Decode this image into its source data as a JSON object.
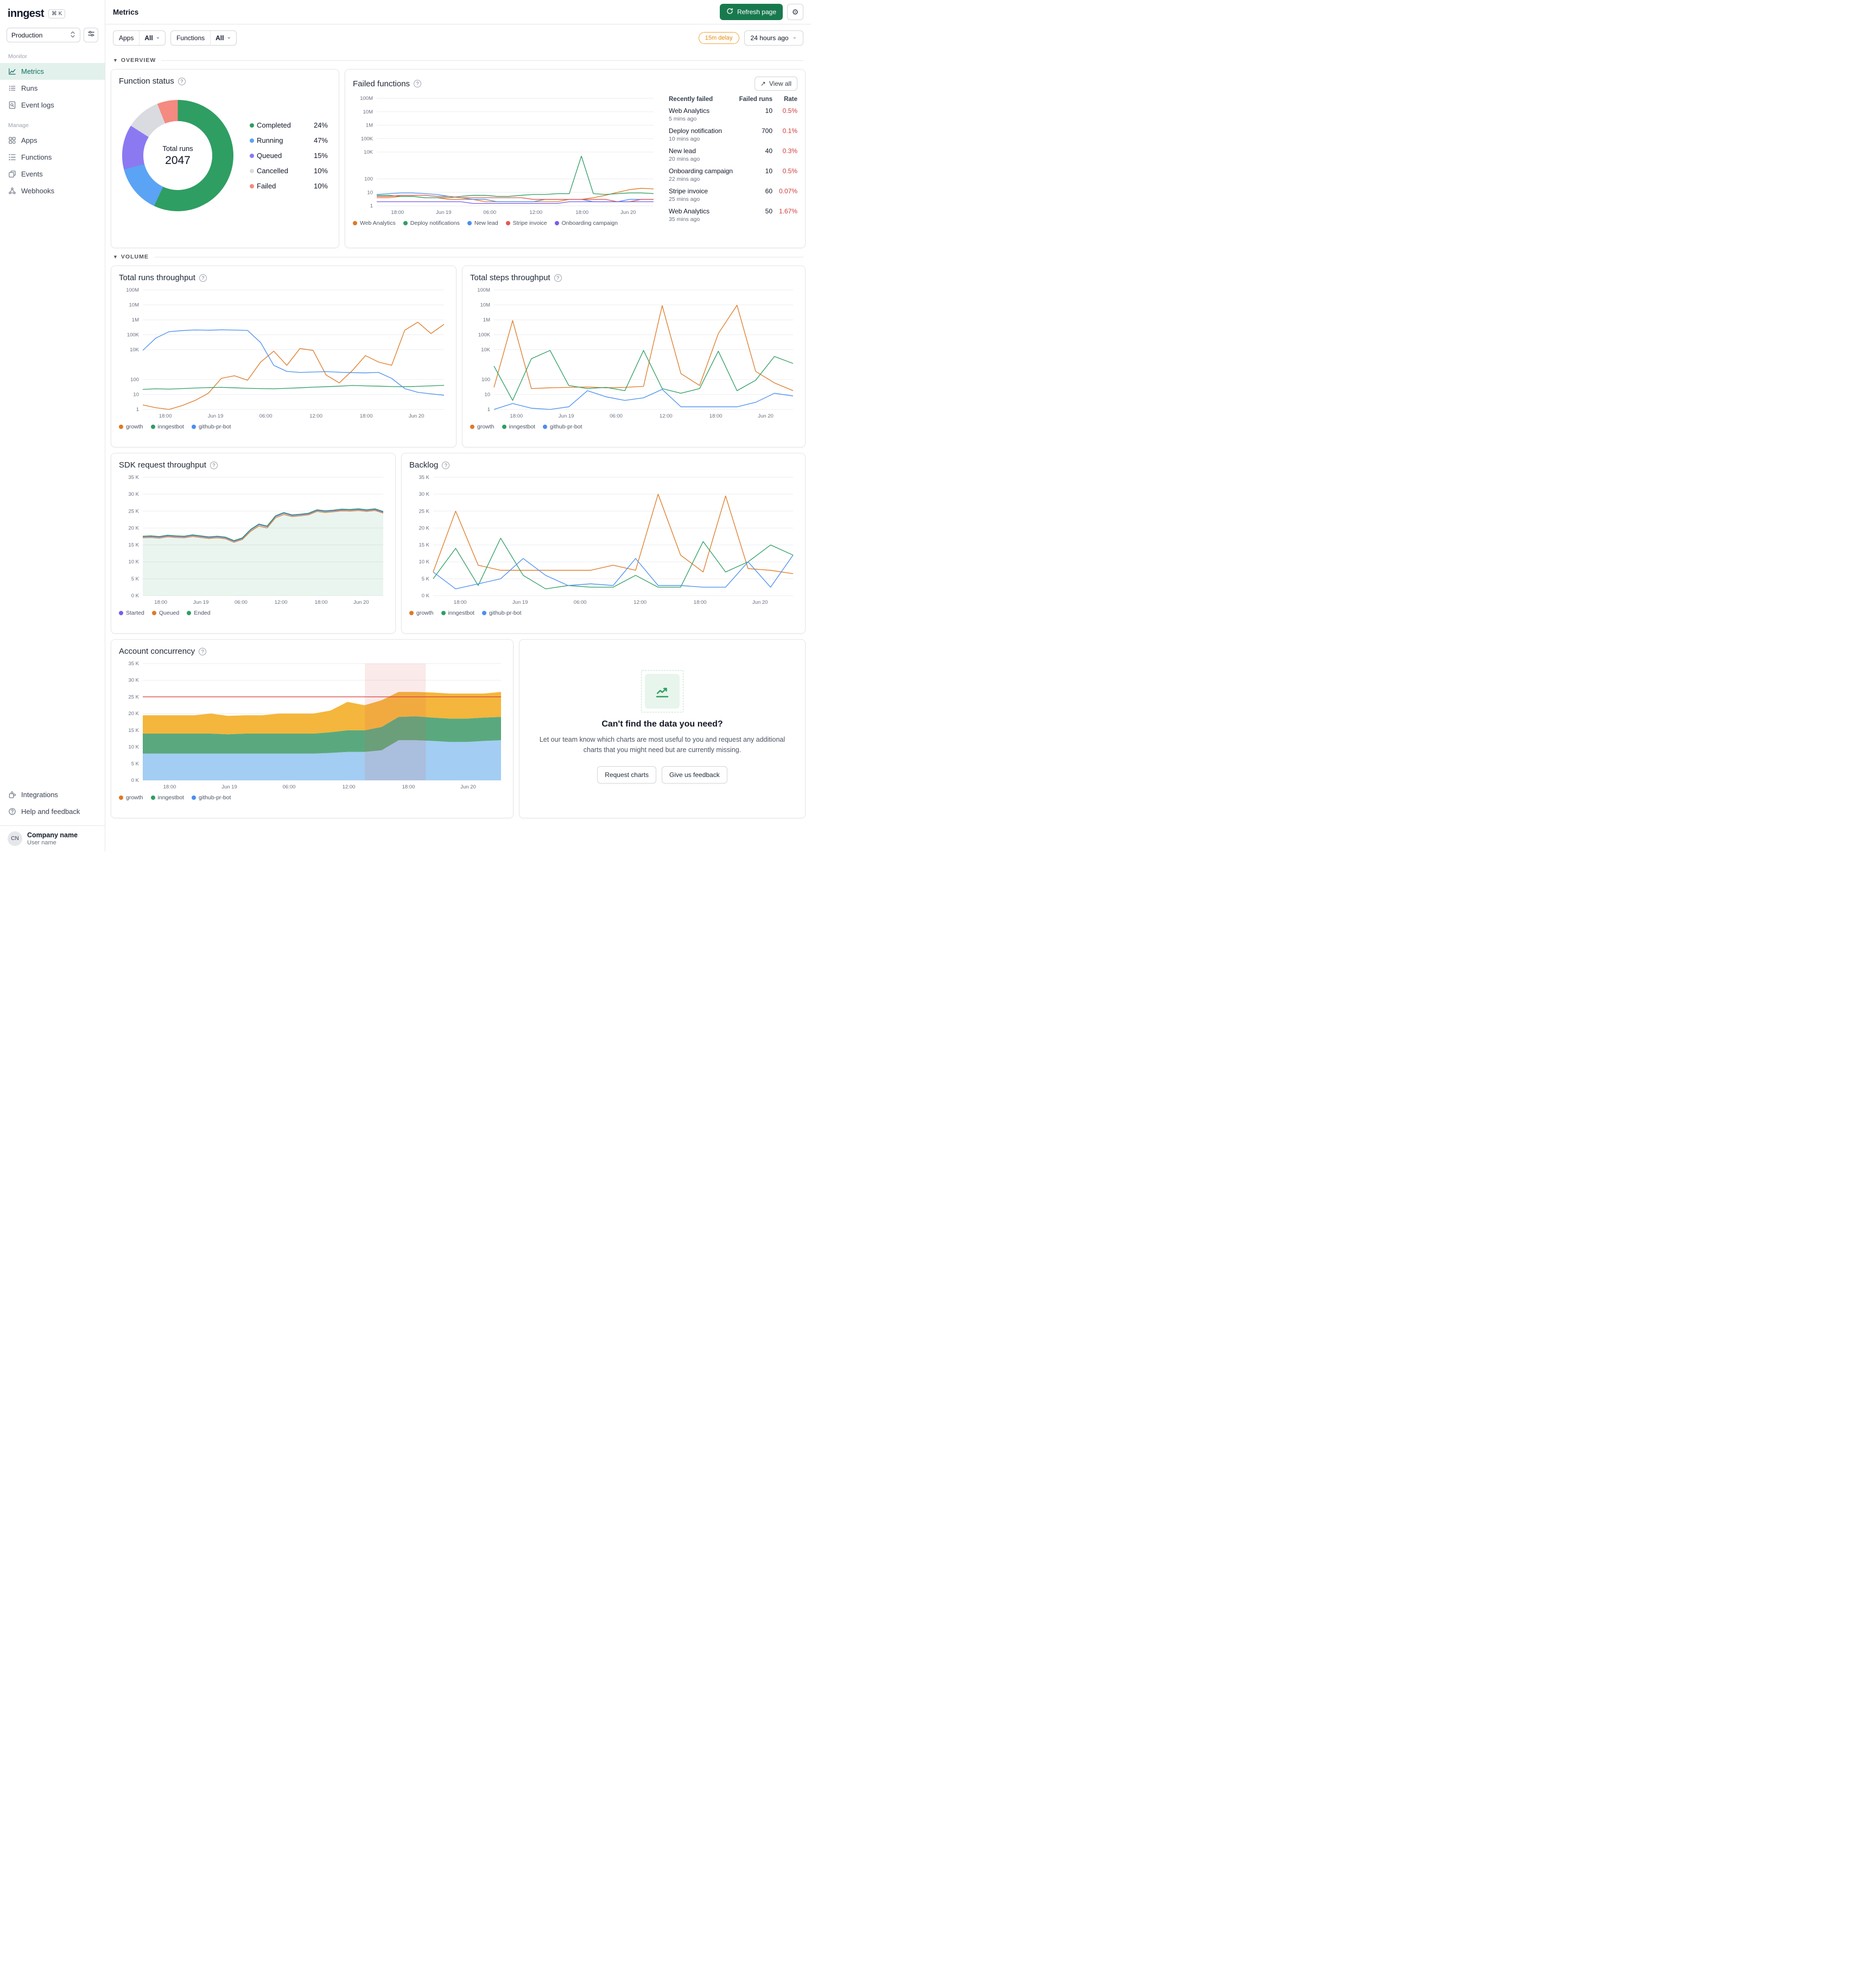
{
  "colors": {
    "accent_green": "#19794e",
    "badge_orange": "#e9890c",
    "error_red": "#d13d3d",
    "active_bg": "#e3f1ec",
    "active_text": "#12715f"
  },
  "sidebar": {
    "logo": "inngest",
    "kbd": "⌘ K",
    "env_selector": "Production",
    "sections": [
      {
        "label": "Monitor",
        "items": [
          {
            "label": "Metrics",
            "icon": "metrics",
            "active": true
          },
          {
            "label": "Runs",
            "icon": "runs"
          },
          {
            "label": "Event logs",
            "icon": "event-logs"
          }
        ]
      },
      {
        "label": "Manage",
        "items": [
          {
            "label": "Apps",
            "icon": "apps"
          },
          {
            "label": "Functions",
            "icon": "functions"
          },
          {
            "label": "Events",
            "icon": "events"
          },
          {
            "label": "Webhooks",
            "icon": "webhooks"
          }
        ]
      }
    ],
    "footer_items": [
      {
        "label": "Integrations",
        "icon": "integrations"
      },
      {
        "label": "Help and feedback",
        "icon": "help"
      }
    ],
    "account": {
      "company": "Company name",
      "user": "User name",
      "avatar": "CN"
    }
  },
  "header": {
    "title": "Metrics",
    "refresh_label": "Refresh page"
  },
  "filters": {
    "apps_label": "Apps",
    "apps_value": "All",
    "functions_label": "Functions",
    "functions_value": "All",
    "delay_badge": "15m delay",
    "time_range": "24 hours ago"
  },
  "sections": {
    "overview": "OVERVIEW",
    "volume": "VOLUME"
  },
  "cards": {
    "failed_functions": {
      "view_all": "View all",
      "table": {
        "headers": {
          "name": "Recently failed",
          "runs": "Failed runs",
          "rate": "Rate"
        },
        "rows": [
          {
            "name": "Web Analytics",
            "time": "5 mins ago",
            "runs": "10",
            "rate": "0.5%"
          },
          {
            "name": "Deploy notification",
            "time": "10 mins ago",
            "runs": "700",
            "rate": "0.1%"
          },
          {
            "name": "New lead",
            "time": "20 mins ago",
            "runs": "40",
            "rate": "0.3%"
          },
          {
            "name": "Onboarding campaign",
            "time": "22 mins ago",
            "runs": "10",
            "rate": "0.5%"
          },
          {
            "name": "Stripe invoice",
            "time": "25 mins ago",
            "runs": "60",
            "rate": "0.07%"
          },
          {
            "name": "Web Analytics",
            "time": "35 mins ago",
            "runs": "50",
            "rate": "1.67%"
          }
        ]
      }
    },
    "feedback": {
      "title": "Can't find the data you need?",
      "body": "Let our team know which charts are most useful to you and request any additional charts that you might need but are currently missing.",
      "request_button": "Request charts",
      "feedback_button": "Give us feedback"
    }
  },
  "chart_data": [
    {
      "type": "donut",
      "title": "Function status",
      "center_label": "Total runs",
      "center_value": "2047",
      "segments": [
        {
          "label": "Completed",
          "pct": "24%",
          "color": "#2f9e63",
          "sweep": 0.57
        },
        {
          "label": "Running",
          "pct": "47%",
          "color": "#5ba3f5",
          "sweep": 0.14
        },
        {
          "label": "Queued",
          "pct": "15%",
          "color": "#8b79f2",
          "sweep": 0.13
        },
        {
          "label": "Cancelled",
          "pct": "10%",
          "color": "#d9dbe0",
          "sweep": 0.1
        },
        {
          "label": "Failed",
          "pct": "10%",
          "color": "#f48a80",
          "sweep": 0.06
        }
      ]
    },
    {
      "type": "line",
      "title": "Failed functions",
      "y_scale": "log",
      "y_ticks": [
        {
          "l": "100M",
          "v": 100000000
        },
        {
          "l": "10M",
          "v": 10000000
        },
        {
          "l": "1M",
          "v": 1000000
        },
        {
          "l": "100K",
          "v": 100000
        },
        {
          "l": "10K",
          "v": 10000
        },
        {
          "l": "100",
          "v": 100
        },
        {
          "l": "10",
          "v": 10
        },
        {
          "l": "1",
          "v": 1
        }
      ],
      "x_ticks": [
        "18:00",
        "Jun 19",
        "06:00",
        "12:00",
        "18:00",
        "Jun 20"
      ],
      "series": [
        {
          "name": "Web Analytics",
          "color": "#dd7a26",
          "values": [
            4,
            4,
            5,
            5,
            4,
            4,
            3,
            3,
            3,
            2,
            2,
            2,
            2,
            2,
            2,
            2,
            3,
            3,
            4,
            6,
            10,
            16,
            20,
            18
          ]
        },
        {
          "name": "Deploy notifications",
          "color": "#2f9e63",
          "values": [
            6,
            6,
            5,
            5,
            4,
            4,
            4,
            5,
            6,
            6,
            5,
            5,
            6,
            7,
            7,
            8,
            8,
            5000,
            8,
            7,
            8,
            9,
            9,
            8
          ]
        },
        {
          "name": "New lead",
          "color": "#4a8ff0",
          "values": [
            7,
            8,
            9,
            9,
            8,
            7,
            5,
            4,
            3,
            3,
            2,
            2,
            2,
            2,
            3,
            3,
            3,
            3,
            2,
            2,
            2,
            3,
            3,
            3
          ]
        },
        {
          "name": "Stripe invoice",
          "color": "#df5a52",
          "values": [
            5,
            5,
            6,
            6,
            6,
            5,
            5,
            4,
            4,
            4,
            4,
            4,
            4,
            3,
            3,
            3,
            3,
            3,
            3,
            3,
            2,
            2,
            3,
            3
          ]
        },
        {
          "name": "Onboarding campaign",
          "color": "#7a5cf0",
          "values": [
            2,
            2,
            2,
            2,
            2,
            2,
            2,
            2,
            1.5,
            1.5,
            1.5,
            1.5,
            1.5,
            1.5,
            1.5,
            1.5,
            2,
            2,
            2,
            2,
            2,
            2,
            2,
            2
          ]
        }
      ]
    },
    {
      "type": "line",
      "title": "Total runs throughput",
      "y_scale": "log",
      "y_ticks": [
        {
          "l": "100M",
          "v": 100000000
        },
        {
          "l": "10M",
          "v": 10000000
        },
        {
          "l": "1M",
          "v": 1000000
        },
        {
          "l": "100K",
          "v": 100000
        },
        {
          "l": "10K",
          "v": 10000
        },
        {
          "l": "100",
          "v": 100
        },
        {
          "l": "10",
          "v": 10
        },
        {
          "l": "1",
          "v": 1
        }
      ],
      "x_ticks": [
        "18:00",
        "Jun 19",
        "06:00",
        "12:00",
        "18:00",
        "Jun 20"
      ],
      "series": [
        {
          "name": "growth",
          "color": "#dd7a26",
          "values": [
            2,
            1.3,
            1,
            1.8,
            4,
            12,
            120,
            180,
            90,
            1500,
            8000,
            900,
            12000,
            9000,
            200,
            60,
            400,
            4000,
            1500,
            900,
            200000,
            700000,
            120000,
            500000
          ]
        },
        {
          "name": "inngestbot",
          "color": "#2f9e63",
          "values": [
            22,
            24,
            23,
            25,
            27,
            29,
            30,
            28,
            26,
            25,
            24,
            26,
            28,
            31,
            33,
            36,
            40,
            38,
            36,
            34,
            33,
            35,
            38,
            41
          ]
        },
        {
          "name": "github-pr-bot",
          "color": "#4a8ff0",
          "values": [
            9000,
            60000,
            160000,
            190000,
            210000,
            200000,
            215000,
            205000,
            195000,
            30000,
            900,
            350,
            300,
            320,
            340,
            310,
            290,
            280,
            300,
            120,
            25,
            14,
            11,
            9
          ]
        }
      ]
    },
    {
      "type": "line",
      "title": "Total steps throughput",
      "y_scale": "log",
      "y_ticks": [
        {
          "l": "100M",
          "v": 100000000
        },
        {
          "l": "10M",
          "v": 10000000
        },
        {
          "l": "1M",
          "v": 1000000
        },
        {
          "l": "100K",
          "v": 100000
        },
        {
          "l": "10K",
          "v": 10000
        },
        {
          "l": "100",
          "v": 100
        },
        {
          "l": "10",
          "v": 10
        },
        {
          "l": "1",
          "v": 1
        }
      ],
      "x_ticks": [
        "18:00",
        "Jun 19",
        "06:00",
        "12:00",
        "18:00",
        "Jun 20"
      ],
      "series": [
        {
          "name": "growth",
          "color": "#dd7a26",
          "values": [
            30,
            900000,
            25,
            28,
            30,
            32,
            28,
            30,
            35,
            9000000,
            250,
            40,
            120000,
            9500000,
            350,
            60,
            18
          ]
        },
        {
          "name": "inngestbot",
          "color": "#2f9e63",
          "values": [
            800,
            4,
            2500,
            9000,
            40,
            25,
            30,
            18,
            9000,
            25,
            12,
            25,
            8000,
            18,
            90,
            3500,
            1200
          ]
        },
        {
          "name": "github-pr-bot",
          "color": "#4a8ff0",
          "values": [
            1,
            2.5,
            1.2,
            1,
            1.5,
            18,
            7,
            4,
            6,
            22,
            1.5,
            1.5,
            1.5,
            1.5,
            3,
            12,
            8
          ]
        }
      ]
    },
    {
      "type": "line",
      "title": "SDK request throughput",
      "y_scale": "linear",
      "y_max": 35,
      "y_ticks": [
        {
          "l": "35 K",
          "v": 35
        },
        {
          "l": "30 K",
          "v": 30
        },
        {
          "l": "25 K",
          "v": 25
        },
        {
          "l": "20 K",
          "v": 20
        },
        {
          "l": "15 K",
          "v": 15
        },
        {
          "l": "10 K",
          "v": 10
        },
        {
          "l": "5 K",
          "v": 5
        },
        {
          "l": "0 K",
          "v": 0
        }
      ],
      "x_ticks": [
        "18:00",
        "Jun 19",
        "06:00",
        "12:00",
        "18:00",
        "Jun 20"
      ],
      "series": [
        {
          "name": "Started",
          "color": "#7a5cf0",
          "values": [
            17.4,
            17.5,
            17.3,
            17.7,
            17.5,
            17.4,
            17.8,
            17.5,
            17.2,
            17.4,
            17.1,
            16.1,
            16.9,
            19.4,
            21.0,
            20.4,
            23.4,
            24.4,
            23.7,
            23.9,
            24.2,
            25.2,
            24.9,
            25.1,
            25.4,
            25.3,
            25.5,
            25.2,
            25.5,
            24.7
          ]
        },
        {
          "name": "Queued",
          "color": "#dd7a26",
          "values": [
            17.1,
            17.2,
            17.0,
            17.4,
            17.2,
            17.1,
            17.5,
            17.2,
            16.9,
            17.1,
            16.8,
            15.8,
            16.6,
            19.0,
            20.6,
            20.0,
            23.0,
            24.0,
            23.4,
            23.6,
            23.9,
            24.9,
            24.6,
            24.8,
            25.1,
            25.0,
            25.2,
            24.9,
            25.2,
            24.4
          ]
        },
        {
          "name": "Ended",
          "color": "#2f9e63",
          "area": true,
          "fill": "rgba(47,158,99,0.10)",
          "values": [
            17.6,
            17.7,
            17.5,
            17.9,
            17.7,
            17.6,
            18.0,
            17.7,
            17.4,
            17.6,
            17.3,
            16.3,
            17.1,
            19.6,
            21.2,
            20.6,
            23.6,
            24.6,
            23.9,
            24.1,
            24.4,
            25.4,
            25.1,
            25.3,
            25.6,
            25.5,
            25.7,
            25.4,
            25.7,
            24.9
          ]
        }
      ]
    },
    {
      "type": "line",
      "title": "Backlog",
      "y_scale": "linear",
      "y_max": 35,
      "y_ticks": [
        {
          "l": "35 K",
          "v": 35
        },
        {
          "l": "30 K",
          "v": 30
        },
        {
          "l": "25 K",
          "v": 25
        },
        {
          "l": "20 K",
          "v": 20
        },
        {
          "l": "15 K",
          "v": 15
        },
        {
          "l": "10 K",
          "v": 10
        },
        {
          "l": "5 K",
          "v": 5
        },
        {
          "l": "0 K",
          "v": 0
        }
      ],
      "x_ticks": [
        "18:00",
        "Jun 19",
        "06:00",
        "12:00",
        "18:00",
        "Jun 20"
      ],
      "series": [
        {
          "name": "growth",
          "color": "#dd7a26",
          "values": [
            7,
            25,
            9,
            7.5,
            7.5,
            7.5,
            7.5,
            7.5,
            9,
            7.5,
            30,
            12,
            7,
            29.5,
            8,
            7.5,
            6.5
          ]
        },
        {
          "name": "inngestbot",
          "color": "#2f9e63",
          "values": [
            5,
            14,
            3,
            17,
            6,
            2,
            3,
            2.5,
            2.5,
            6,
            2.5,
            2.5,
            16,
            7,
            10,
            15,
            12
          ]
        },
        {
          "name": "github-pr-bot",
          "color": "#4a8ff0",
          "values": [
            7,
            2,
            3.5,
            5,
            11,
            6,
            3,
            3.5,
            3,
            11,
            3,
            3,
            2.5,
            2.5,
            10,
            2.5,
            12
          ]
        }
      ]
    },
    {
      "type": "line",
      "title": "Account concurrency",
      "y_scale": "linear",
      "y_max": 35,
      "stacked": true,
      "limit": 25,
      "band": [
        0.62,
        0.79
      ],
      "y_ticks": [
        {
          "l": "35 K",
          "v": 35
        },
        {
          "l": "30 K",
          "v": 30
        },
        {
          "l": "25 K",
          "v": 25
        },
        {
          "l": "20 K",
          "v": 20
        },
        {
          "l": "15 K",
          "v": 15
        },
        {
          "l": "10 K",
          "v": 10
        },
        {
          "l": "5 K",
          "v": 5
        },
        {
          "l": "0 K",
          "v": 0
        }
      ],
      "x_ticks": [
        "18:00",
        "Jun 19",
        "06:00",
        "12:00",
        "18:00",
        "Jun 20"
      ],
      "series": [
        {
          "name": "github-pr-bot",
          "color": "#4a8ff0",
          "fill": "#a3cdf2",
          "values": [
            8,
            8,
            8,
            8,
            8,
            8,
            8,
            8,
            8,
            8,
            8,
            8.2,
            8.5,
            8.5,
            9,
            12,
            12,
            11.8,
            11.5,
            11.5,
            11.8,
            12
          ]
        },
        {
          "name": "inngestbot",
          "color": "#2f9e63",
          "fill": "#5aa97e",
          "values": [
            6,
            6,
            6,
            6,
            6,
            5.8,
            6,
            6,
            6,
            6,
            6,
            6.2,
            6.5,
            6.5,
            7,
            7,
            7.2,
            7,
            7,
            7,
            7,
            7
          ]
        },
        {
          "name": "growth",
          "color": "#dd7a26",
          "fill": "#f4b63c",
          "values": [
            5.5,
            5.5,
            5.5,
            5.5,
            6,
            5.5,
            5.5,
            5.5,
            6,
            6,
            6,
            6.5,
            8.5,
            7.5,
            8,
            7.5,
            7.3,
            7.5,
            7.5,
            7.5,
            7.2,
            7.5
          ]
        }
      ],
      "legend": [
        {
          "label": "growth",
          "color": "#dd7a26"
        },
        {
          "label": "inngestbot",
          "color": "#2f9e63"
        },
        {
          "label": "github-pr-bot",
          "color": "#4a8ff0"
        }
      ]
    }
  ]
}
